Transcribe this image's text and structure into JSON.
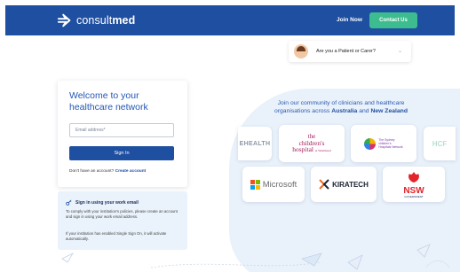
{
  "header": {
    "logo_part1": "consult",
    "logo_part2": "med",
    "join_label": "Join Now",
    "contact_label": "Contact Us"
  },
  "patient_select": {
    "label": "Are you a Patient or Carer?"
  },
  "login": {
    "title_line1": "Welcome to your",
    "title_line2": "healthcare network",
    "email_placeholder": "Email address*",
    "signin_label": "Sign In",
    "no_account_text": "Don't have an account?",
    "create_account_label": "Create account"
  },
  "work_email": {
    "title": "Sign in using your work email",
    "para1": "To comply with your institution's policies, please create an account and sign in using your work email address.",
    "para2": "If your institution has enabled Single Sign On, it will activate automatically."
  },
  "community": {
    "line1": "Join our community of clinicians and healthcare",
    "line2_prefix": "organisations across ",
    "country1": "Australia",
    "and": " and ",
    "country2": "New Zealand"
  },
  "partners": {
    "ehealth": "EHEALTH",
    "childrens_l1": "the",
    "childrens_l2": "children's",
    "childrens_l3": "hospital",
    "childrens_l3_small": "at Westmead",
    "sydney_l1": "The Sydney",
    "sydney_l2": "children's",
    "sydney_l3": "Hospitals Network",
    "hc": "HCF",
    "microsoft": "Microsoft",
    "kiratech": "KIRATECH",
    "nsw": "NSW",
    "nsw_gov": "GOVERNMENT"
  },
  "colors": {
    "brand_blue": "#1f4fa0",
    "accent_green": "#3dbd8f",
    "panel_bg": "#e9f1fa"
  }
}
